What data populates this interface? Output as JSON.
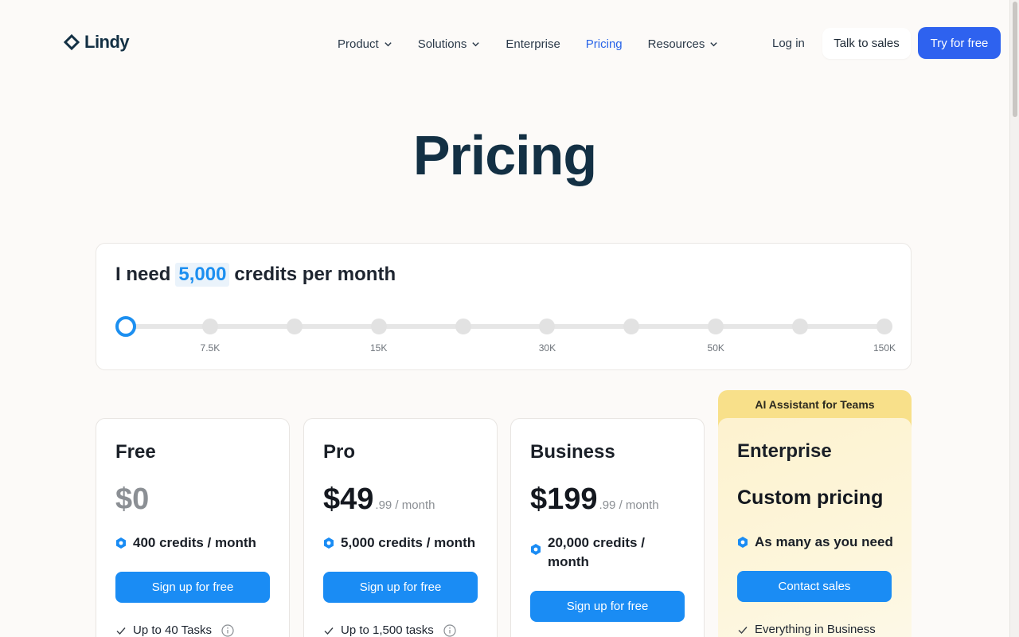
{
  "brand": {
    "name": "Lindy"
  },
  "nav": {
    "items": [
      {
        "label": "Product",
        "dropdown": true,
        "active": false
      },
      {
        "label": "Solutions",
        "dropdown": true,
        "active": false
      },
      {
        "label": "Enterprise",
        "dropdown": false,
        "active": false
      },
      {
        "label": "Pricing",
        "dropdown": false,
        "active": true
      },
      {
        "label": "Resources",
        "dropdown": true,
        "active": false
      }
    ],
    "login": "Log in",
    "talk_to_sales": "Talk to sales",
    "try_free": "Try for free"
  },
  "page": {
    "title": "Pricing"
  },
  "credits": {
    "prefix": "I need",
    "amount": "5,000",
    "suffix": "credits per month",
    "selected_index": 0,
    "stop_count": 10,
    "ticks": [
      {
        "index": 1,
        "label": "7.5K"
      },
      {
        "index": 3,
        "label": "15K"
      },
      {
        "index": 5,
        "label": "30K"
      },
      {
        "index": 7,
        "label": "50K"
      },
      {
        "index": 9,
        "label": "150K"
      }
    ]
  },
  "plans": {
    "free": {
      "name": "Free",
      "price": "$0",
      "credits": "400 credits / month",
      "cta": "Sign up for free",
      "feature": "Up to 40 Tasks"
    },
    "pro": {
      "name": "Pro",
      "price": "$49",
      "price_cents": ".99 / month",
      "credits": "5,000 credits / month",
      "cta": "Sign up for free",
      "feature": "Up to 1,500 tasks"
    },
    "business": {
      "name": "Business",
      "price": "$199",
      "price_cents": ".99 / month",
      "credits": "20,000 credits / month",
      "cta": "Sign up for free"
    },
    "enterprise": {
      "banner": "AI Assistant for Teams",
      "name": "Enterprise",
      "price": "Custom pricing",
      "credits": "As many as you need",
      "cta": "Contact sales",
      "feature": "Everything in Business"
    }
  },
  "colors": {
    "primary": "#2e62ef",
    "accent_blue": "#1a8cf4",
    "title_navy": "#133044",
    "enterprise_gold": "#f8e08a"
  },
  "icons": {
    "logo": "diamond-chevron-icon",
    "dropdown": "chevron-down-icon",
    "credits": "hexagon-icon",
    "feature": "check-icon",
    "info": "info-icon"
  }
}
